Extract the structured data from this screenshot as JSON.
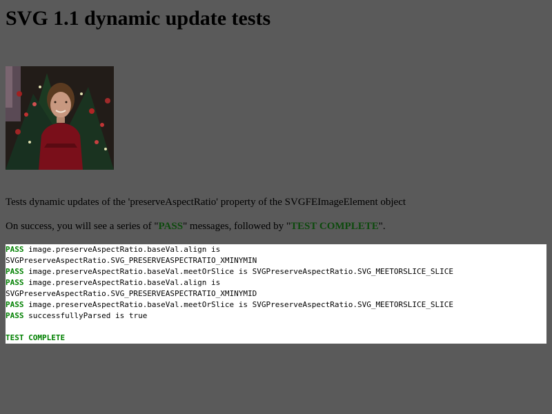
{
  "page": {
    "title": "SVG 1.1 dynamic update tests",
    "description": "Tests dynamic updates of the 'preserveAspectRatio' property of the SVGFEImageElement object",
    "success_prefix": "On success, you will see a series of \"",
    "success_pass": "PASS",
    "success_middle": "\" messages, followed by \"",
    "success_complete": "TEST COMPLETE",
    "success_suffix": "\"."
  },
  "console": {
    "lines": [
      {
        "status": "PASS",
        "text": "image.preserveAspectRatio.baseVal.align is"
      },
      {
        "status": "",
        "text": "SVGPreserveAspectRatio.SVG_PRESERVEASPECTRATIO_XMINYMIN"
      },
      {
        "status": "PASS",
        "text": "image.preserveAspectRatio.baseVal.meetOrSlice is SVGPreserveAspectRatio.SVG_MEETORSLICE_SLICE"
      },
      {
        "status": "PASS",
        "text": "image.preserveAspectRatio.baseVal.align is"
      },
      {
        "status": "",
        "text": "SVGPreserveAspectRatio.SVG_PRESERVEASPECTRATIO_XMINYMID"
      },
      {
        "status": "PASS",
        "text": "image.preserveAspectRatio.baseVal.meetOrSlice is SVGPreserveAspectRatio.SVG_MEETORSLICE_SLICE"
      },
      {
        "status": "PASS",
        "text": "successfullyParsed is true"
      }
    ],
    "complete": "TEST COMPLETE"
  },
  "colors": {
    "background": "#5a5a5a",
    "pass": "#008000",
    "highlight": "#0d4a0d"
  },
  "icons": {
    "photo": "child-christmas-tree-photo"
  }
}
